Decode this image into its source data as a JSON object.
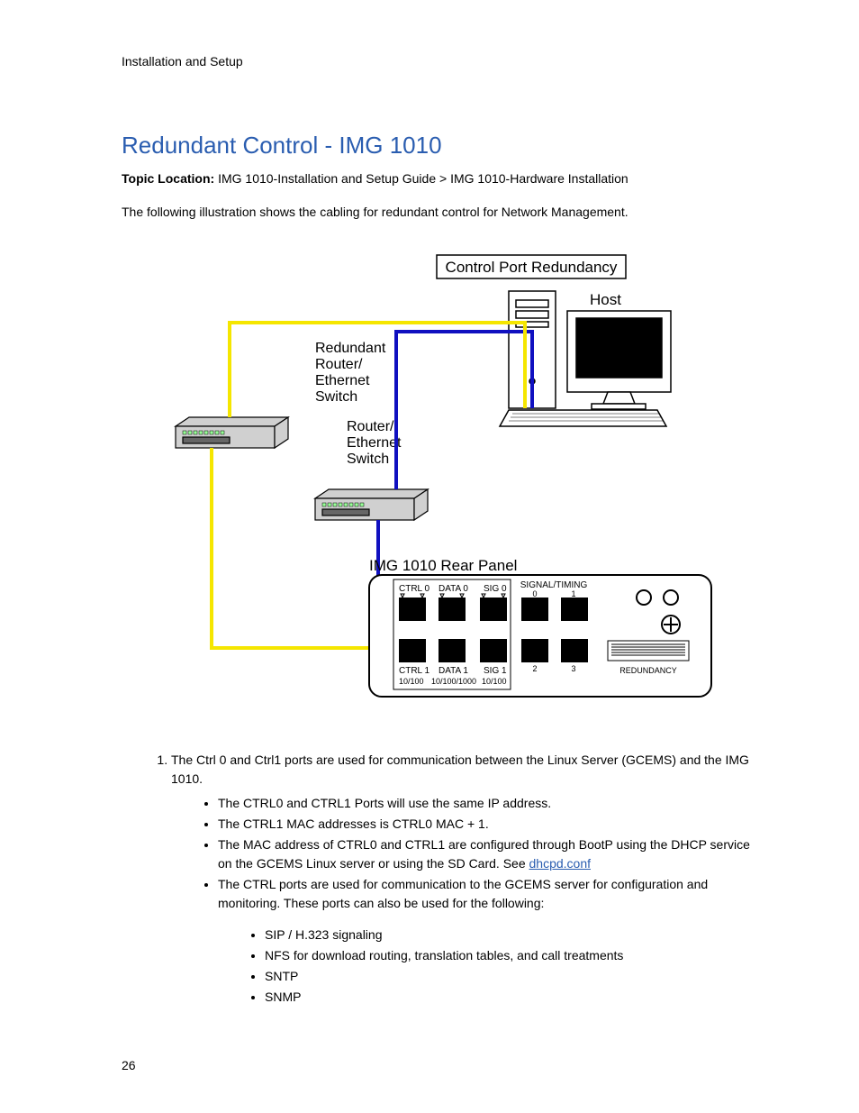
{
  "running_head": "Installation and Setup",
  "title": "Redundant Control - IMG 1010",
  "topic_location_label": "Topic Location:",
  "topic_location_value": " IMG 1010-Installation and Setup Guide > IMG 1010-Hardware Installation",
  "intro": "The following illustration shows the cabling for redundant control for Network Management.",
  "figure": {
    "box_title": "Control Port Redundancy",
    "host": "Host",
    "redundant_switch": "Redundant\nRouter/\nEthernet\nSwitch",
    "switch": "Router/\nEthernet\nSwitch",
    "panel_title": "IMG 1010 Rear  Panel",
    "ports": {
      "ctrl0": "CTRL 0",
      "data0": "DATA 0",
      "sig0": "SIG 0",
      "signal_timing": "SIGNAL/TIMING",
      "st0": "0",
      "st1": "1",
      "ctrl1": "CTRL 1",
      "data1": "DATA 1",
      "sig1": "SIG 1",
      "st2": "2",
      "st3": "3",
      "redundancy": "REDUNDANCY",
      "ctrl_speed": "10/100",
      "data_speed": "10/100/1000",
      "sig_speed": "10/100"
    }
  },
  "list": {
    "item1": "The Ctrl 0 and Ctrl1 ports are used for communication between the Linux Server (GCEMS) and the IMG 1010.",
    "b1": "The CTRL0 and CTRL1 Ports will use the same IP address.",
    "b2": "The CTRL1 MAC addresses is CTRL0 MAC + 1.",
    "b3a": "The MAC address of CTRL0 and CTRL1 are configured through BootP using the DHCP service on the GCEMS Linux server or using the SD Card. See ",
    "b3_link": "dhcpd.conf",
    "b4": "The CTRL ports are used for communication to the GCEMS server for configuration and monitoring. These ports can also be used for the following:",
    "s1": "SIP / H.323 signaling",
    "s2": "NFS for download routing, translation tables, and call treatments",
    "s3": "SNTP",
    "s4": "SNMP"
  },
  "page_number": "26"
}
